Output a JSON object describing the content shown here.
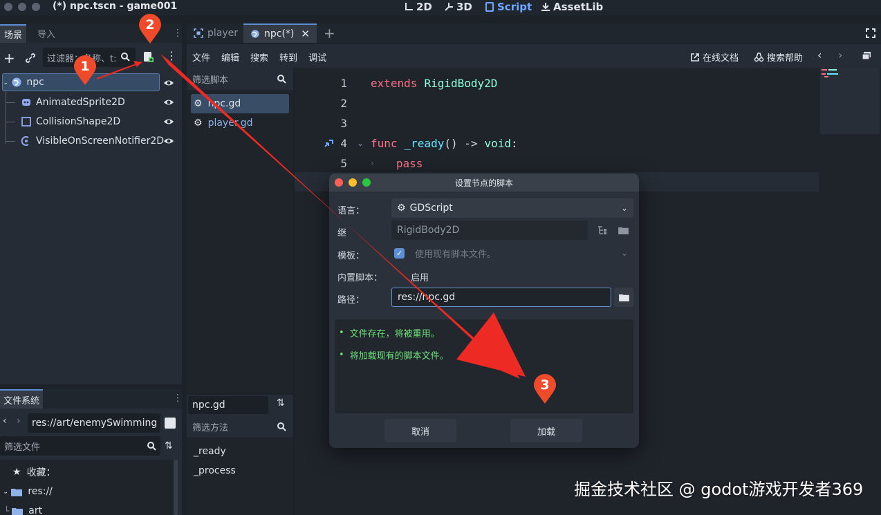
{
  "window": {
    "title": "(*) npc.tscn - game001"
  },
  "modes": [
    {
      "label": "2D",
      "icon": "2d-icon"
    },
    {
      "label": "3D",
      "icon": "3d-icon"
    },
    {
      "label": "Script",
      "icon": "script-icon"
    },
    {
      "label": "AssetLib",
      "icon": "assetlib-icon"
    }
  ],
  "scene_dock": {
    "tabs": [
      "场景",
      "导入"
    ],
    "filter_placeholder": "过滤器：名称、t:",
    "nodes": [
      {
        "name": "npc",
        "icon": "globe-icon"
      },
      {
        "name": "AnimatedSprite2D",
        "icon": "animated-sprite-icon"
      },
      {
        "name": "CollisionShape2D",
        "icon": "collision-shape-icon"
      },
      {
        "name": "VisibleOnScreenNotifier2D",
        "icon": "notifier-icon"
      }
    ]
  },
  "editor": {
    "tabs": [
      {
        "label": "player",
        "icon": "viewport-icon"
      },
      {
        "label": "npc(*)",
        "icon": "globe-icon"
      }
    ],
    "menu": [
      "文件",
      "编辑",
      "搜索",
      "转到",
      "调试"
    ],
    "online_docs": "在线文档",
    "search_help": "搜索帮助",
    "script_filter_placeholder": "筛选脚本",
    "scripts": [
      "npc.gd",
      "player.gd"
    ],
    "current_script": "npc.gd",
    "method_filter_placeholder": "筛选方法",
    "methods": [
      "_ready",
      "_process"
    ],
    "line_numbers": [
      "1",
      "2",
      "3",
      "4",
      "5"
    ],
    "code": {
      "line1_kw": "extends",
      "line1_cls": "RigidBody2D",
      "line4_kw": "func",
      "line4_name": "_ready",
      "line4_sig": "() ->",
      "line4_type": "void",
      "line4_colon": ":",
      "line5_kw": "pass"
    }
  },
  "filesystem": {
    "tab": "文件系统",
    "path": "res://art/enemySwimming_",
    "filter_placeholder": "筛选文件",
    "items": [
      {
        "label": "收藏：",
        "icon": "star-icon"
      },
      {
        "label": "res://",
        "icon": "folder-icon"
      },
      {
        "label": "art",
        "icon": "folder-icon"
      }
    ]
  },
  "dialog": {
    "title": "设置节点的脚本",
    "language_label": "语言：",
    "language_value": "GDScript",
    "inherits_label": "继",
    "inherits_value": "RigidBody2D",
    "template_label": "模板：",
    "template_value": "使用现有脚本文件。",
    "builtin_label": "内置脚本：",
    "builtin_value": "启用",
    "path_label": "路径：",
    "path_value": "res://npc.gd",
    "messages": [
      "文件存在，将被重用。",
      "将加载现有的脚本文件。"
    ],
    "cancel": "取消",
    "load": "加载"
  },
  "annotations": {
    "badges": [
      "1",
      "2",
      "3"
    ]
  },
  "watermark": "掘金技术社区 @ godot游戏开发者369",
  "colors": {
    "accent": "#6fa7ff",
    "keyword": "#ff7085",
    "type": "#8effda",
    "func_name": "#66e6ff",
    "success": "#6ee07a",
    "annotation_red": "#ee2a24"
  }
}
